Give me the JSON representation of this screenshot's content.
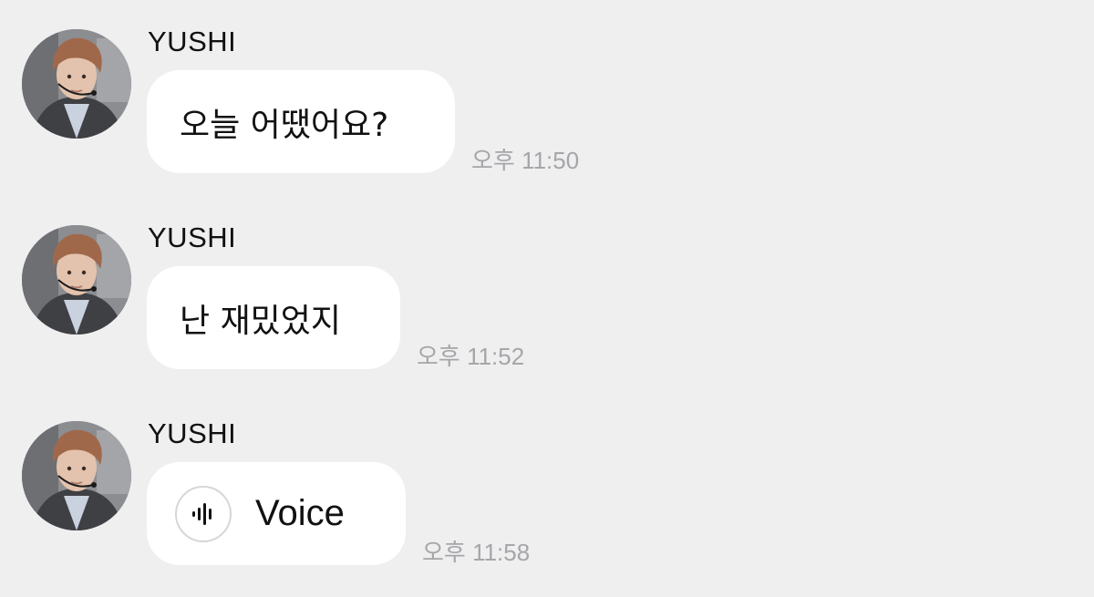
{
  "messages": [
    {
      "sender": "YUSHI",
      "text": "오늘 어땠어요?",
      "time": "오후 11:50",
      "type": "text"
    },
    {
      "sender": "YUSHI",
      "text": "난 재밌었지",
      "time": "오후 11:52",
      "type": "text"
    },
    {
      "sender": "YUSHI",
      "text": "Voice",
      "time": "오후 11:58",
      "type": "voice",
      "icon": "voice-waveform-icon"
    }
  ],
  "colors": {
    "background": "#efeff0",
    "bubble": "#ffffff",
    "text": "#111111",
    "timestamp": "#a6a6aa"
  }
}
